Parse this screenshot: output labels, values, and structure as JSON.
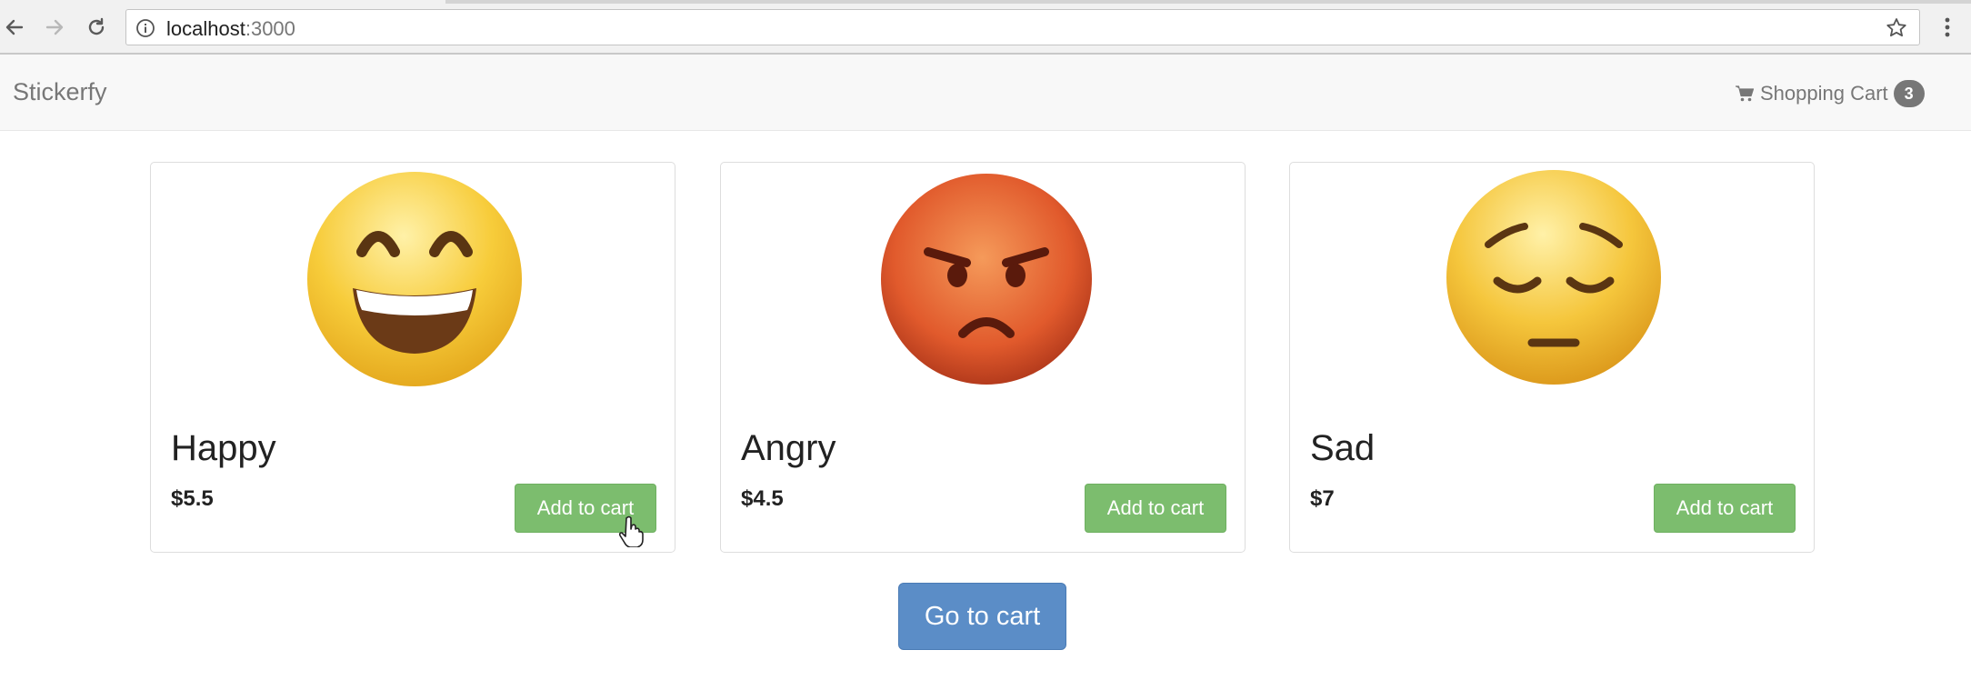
{
  "browser": {
    "url_host": "localhost",
    "url_port": ":3000",
    "icons": [
      "back-arrow-icon",
      "forward-arrow-icon",
      "reload-icon",
      "info-icon",
      "star-icon",
      "menu-dots-icon"
    ]
  },
  "navbar": {
    "brand": "Stickerfy",
    "cart_label": "Shopping Cart",
    "cart_count": "3"
  },
  "products": [
    {
      "name": "Happy",
      "price": "$5.5",
      "button": "Add to cart",
      "emoji": "grinning-face-icon"
    },
    {
      "name": "Angry",
      "price": "$4.5",
      "button": "Add to cart",
      "emoji": "angry-face-icon"
    },
    {
      "name": "Sad",
      "price": "$7",
      "button": "Add to cart",
      "emoji": "pensive-face-icon"
    }
  ],
  "go_to_cart": "Go to cart",
  "colors": {
    "add_button": "#7cbd6e",
    "go_cart_button": "#5b8dc7",
    "badge": "#777777",
    "navbar_bg": "#f8f8f8"
  }
}
